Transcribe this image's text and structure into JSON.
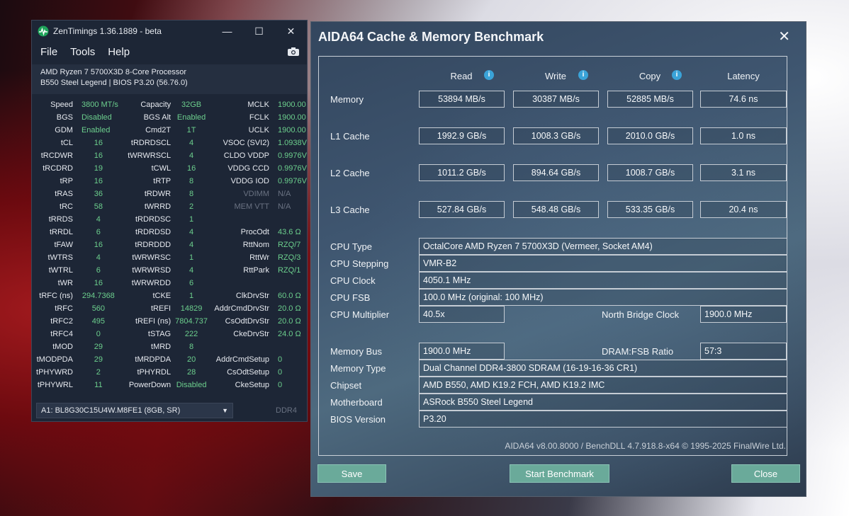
{
  "zentimings": {
    "title": "ZenTimings 1.36.1889 - beta",
    "menu": [
      "File",
      "Tools",
      "Help"
    ],
    "cpu_name": "AMD Ryzen 7 5700X3D 8-Core Processor",
    "board": "B550 Steel Legend | BIOS P3.20 (56.76.0)",
    "rows": [
      [
        "Speed",
        "3800 MT/s",
        "Capacity",
        "32GB",
        "MCLK",
        "1900.00"
      ],
      [
        "BGS",
        "Disabled",
        "BGS Alt",
        "Enabled",
        "FCLK",
        "1900.00"
      ],
      [
        "GDM",
        "Enabled",
        "Cmd2T",
        "1T",
        "UCLK",
        "1900.00"
      ],
      [
        "tCL",
        "16",
        "tRDRDSCL",
        "4",
        "VSOC (SVI2)",
        "1.0938V"
      ],
      [
        "tRCDWR",
        "16",
        "tWRWRSCL",
        "4",
        "CLDO VDDP",
        "0.9976V"
      ],
      [
        "tRCDRD",
        "19",
        "tCWL",
        "16",
        "VDDG CCD",
        "0.9976V"
      ],
      [
        "tRP",
        "16",
        "tRTP",
        "8",
        "VDDG IOD",
        "0.9976V"
      ],
      [
        "tRAS",
        "36",
        "tRDWR",
        "8",
        "VDIMM",
        "N/A"
      ],
      [
        "tRC",
        "58",
        "tWRRD",
        "2",
        "MEM VTT",
        "N/A"
      ],
      [
        "tRRDS",
        "4",
        "tRDRDSC",
        "1",
        "",
        ""
      ],
      [
        "tRRDL",
        "6",
        "tRDRDSD",
        "4",
        "ProcOdt",
        "43.6 Ω"
      ],
      [
        "tFAW",
        "16",
        "tRDRDDD",
        "4",
        "RttNom",
        "RZQ/7"
      ],
      [
        "tWTRS",
        "4",
        "tWRWRSC",
        "1",
        "RttWr",
        "RZQ/3"
      ],
      [
        "tWTRL",
        "6",
        "tWRWRSD",
        "4",
        "RttPark",
        "RZQ/1"
      ],
      [
        "tWR",
        "16",
        "tWRWRDD",
        "6",
        "",
        ""
      ],
      [
        "tRFC (ns)",
        "294.7368",
        "tCKE",
        "1",
        "ClkDrvStr",
        "60.0 Ω"
      ],
      [
        "tRFC",
        "560",
        "tREFI",
        "14829",
        "AddrCmdDrvStr",
        "20.0 Ω"
      ],
      [
        "tRFC2",
        "495",
        "tREFI (ns)",
        "7804.737",
        "CsOdtDrvStr",
        "20.0 Ω"
      ],
      [
        "tRFC4",
        "0",
        "tSTAG",
        "222",
        "CkeDrvStr",
        "24.0 Ω"
      ],
      [
        "tMOD",
        "29",
        "tMRD",
        "8",
        "",
        ""
      ],
      [
        "tMODPDA",
        "29",
        "tMRDPDA",
        "20",
        "AddrCmdSetup",
        "0"
      ],
      [
        "tPHYWRD",
        "2",
        "tPHYRDL",
        "28",
        "CsOdtSetup",
        "0"
      ],
      [
        "tPHYWRL",
        "11",
        "PowerDown",
        "Disabled",
        "CkeSetup",
        "0"
      ]
    ],
    "dimm": "A1: BL8G30C15U4W.M8FE1 (8GB, SR)",
    "ddr": "DDR4"
  },
  "aida": {
    "title": "AIDA64 Cache & Memory Benchmark",
    "columns": [
      "Read",
      "Write",
      "Copy",
      "Latency"
    ],
    "bench": [
      {
        "label": "Memory",
        "read": "53894 MB/s",
        "write": "30387 MB/s",
        "copy": "52885 MB/s",
        "latency": "74.6 ns"
      },
      {
        "label": "L1 Cache",
        "read": "1992.9 GB/s",
        "write": "1008.3 GB/s",
        "copy": "2010.0 GB/s",
        "latency": "1.0 ns"
      },
      {
        "label": "L2 Cache",
        "read": "1011.2 GB/s",
        "write": "894.64 GB/s",
        "copy": "1008.7 GB/s",
        "latency": "3.1 ns"
      },
      {
        "label": "L3 Cache",
        "read": "527.84 GB/s",
        "write": "548.48 GB/s",
        "copy": "533.35 GB/s",
        "latency": "20.4 ns"
      }
    ],
    "cpu_type_label": "CPU Type",
    "cpu_type": "OctalCore AMD Ryzen 7 5700X3D  (Vermeer, Socket AM4)",
    "cpu_stepping_label": "CPU Stepping",
    "cpu_stepping": "VMR-B2",
    "cpu_clock_label": "CPU Clock",
    "cpu_clock": "4050.1 MHz",
    "cpu_fsb_label": "CPU FSB",
    "cpu_fsb": "100.0 MHz  (original: 100 MHz)",
    "cpu_mult_label": "CPU Multiplier",
    "cpu_mult": "40.5x",
    "nb_clock_label": "North Bridge Clock",
    "nb_clock": "1900.0 MHz",
    "mem_bus_label": "Memory Bus",
    "mem_bus": "1900.0 MHz",
    "dram_ratio_label": "DRAM:FSB Ratio",
    "dram_ratio": "57:3",
    "mem_type_label": "Memory Type",
    "mem_type": "Dual Channel DDR4-3800 SDRAM  (16-19-16-36 CR1)",
    "chipset_label": "Chipset",
    "chipset": "AMD B550, AMD K19.2 FCH, AMD K19.2 IMC",
    "mobo_label": "Motherboard",
    "mobo": "ASRock B550 Steel Legend",
    "bios_label": "BIOS Version",
    "bios": "P3.20",
    "footer": "AIDA64 v8.00.8000 / BenchDLL 4.7.918.8-x64 © 1995-2025 FinalWire Ltd.",
    "buttons": {
      "save": "Save",
      "start": "Start Benchmark",
      "close": "Close"
    }
  }
}
